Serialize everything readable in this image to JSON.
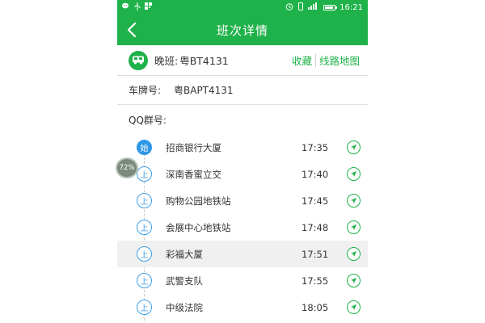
{
  "status_bar": {
    "time": "16:21",
    "battery_level": 0.9,
    "left_icons": [
      "wechat-icon",
      "usb-icon",
      "barcode-icon"
    ],
    "right_icons": [
      "alarm-icon",
      "vibrate-icon",
      "signal-icon",
      "battery-icon"
    ]
  },
  "header": {
    "title": "班次详情",
    "back_icon": "chevron-left-icon"
  },
  "route": {
    "shift_label": "晚班:",
    "route_code": "粤BT4131",
    "favorite_label": "收藏",
    "map_label": "线路地图"
  },
  "plate": {
    "label": "车牌号:",
    "value": "粤BAPT4131"
  },
  "qq": {
    "label": "QQ群号:"
  },
  "stops": [
    {
      "marker": "始",
      "name": "招商银行大厦",
      "time": "17:35"
    },
    {
      "marker": "上",
      "name": "深南香蜜立交",
      "time": "17:40"
    },
    {
      "marker": "上",
      "name": "购物公园地铁站",
      "time": "17:45"
    },
    {
      "marker": "上",
      "name": "会展中心地铁站",
      "time": "17:48"
    },
    {
      "marker": "上",
      "name": "彩福大厦",
      "time": "17:51"
    },
    {
      "marker": "上",
      "name": "武警支队",
      "time": "17:55"
    },
    {
      "marker": "上",
      "name": "中级法院",
      "time": "18:05"
    }
  ],
  "floating_badge": "72%",
  "colors": {
    "primary": "#1fb24a",
    "marker_blue": "#2f97e6",
    "highlight_row": "#f0f0f0"
  }
}
